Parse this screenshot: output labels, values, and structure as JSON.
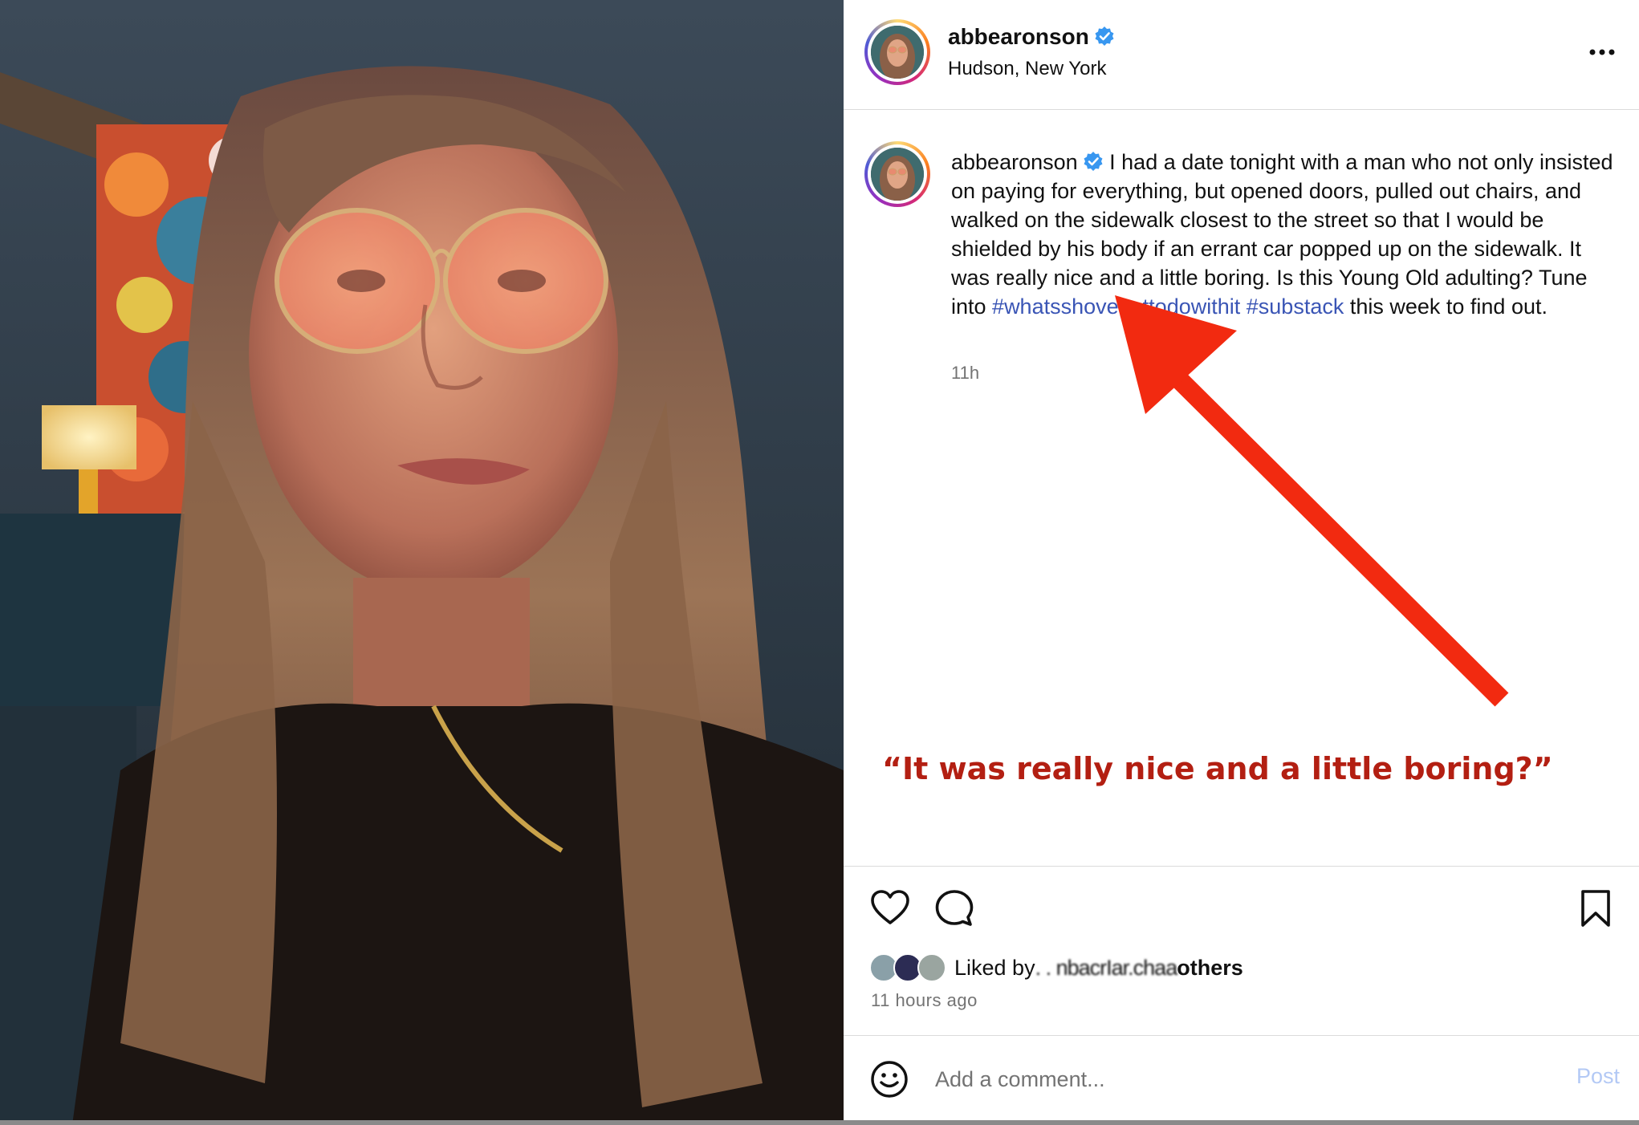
{
  "post": {
    "username": "abbearonson",
    "location": "Hudson, New York",
    "verified": true,
    "caption_text": "I had a date tonight with a man who not only insisted on paying for everything, but opened doors, pulled out chairs, and walked on the sidewalk closest to the street so that I would be shielded by his body if an errant car popped up on the sidewalk. It was really nice and a little boring. Is this Young Old adulting? Tune into ",
    "hashtag_1": "#whatsshovegottodowithit",
    "hashtag_2": "#substack",
    "caption_tail": " this week to find out.",
    "time_short": "11h",
    "time_long": "11 hours ago"
  },
  "likes": {
    "prefix": "Liked by",
    "obscured_1": "  .  .  nbacr",
    "obscured_2": "  Iar.cha",
    "obscured_3": "  a",
    "others": "others"
  },
  "comment_box": {
    "placeholder": "Add a comment...",
    "post_label": "Post"
  },
  "annotation": {
    "text": "“It was really nice and a little boring?”",
    "color": "#b31f12"
  },
  "icons": {
    "more": "more-options-icon",
    "verified": "verified-badge-icon",
    "like": "heart-icon",
    "comment": "comment-bubble-icon",
    "save": "bookmark-icon",
    "emoji": "emoji-icon"
  },
  "colors": {
    "hashtag": "#3a55b5",
    "post_button_disabled": "#b3c9f5",
    "arrow": "#f22a10",
    "verified": "#3897f0"
  }
}
